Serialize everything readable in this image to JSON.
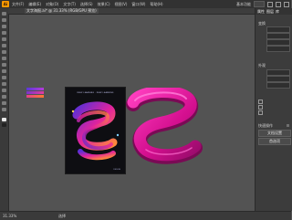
{
  "app": {
    "logo_text": "Ai"
  },
  "menu": [
    "文件(F)",
    "编辑(E)",
    "对象(O)",
    "文字(T)",
    "选择(S)",
    "效果(C)",
    "视图(V)",
    "窗口(W)",
    "帮助(H)"
  ],
  "menubar_right": {
    "workspace": "基本功能"
  },
  "document_tab": {
    "label": "文字海报.ai* @ 31.33% (RGB/GPU 预览)"
  },
  "panel": {
    "tabs": [
      "属性",
      "图层",
      "库"
    ],
    "sections": [
      "变换",
      "外观",
      "快速操作"
    ],
    "buttons": [
      "文档设置",
      "首选项"
    ]
  },
  "artboard": {
    "title": "DEEP LEARNING · DEEP LEARNING",
    "footer": "DESIGN"
  },
  "status": {
    "zoom": "31.33%",
    "text": "选择"
  },
  "colors": {
    "accent_pink": "#e8169a",
    "accent_purple": "#6a2bd8",
    "accent_orange": "#ff7a2f",
    "app_orange": "#ff9a00"
  }
}
